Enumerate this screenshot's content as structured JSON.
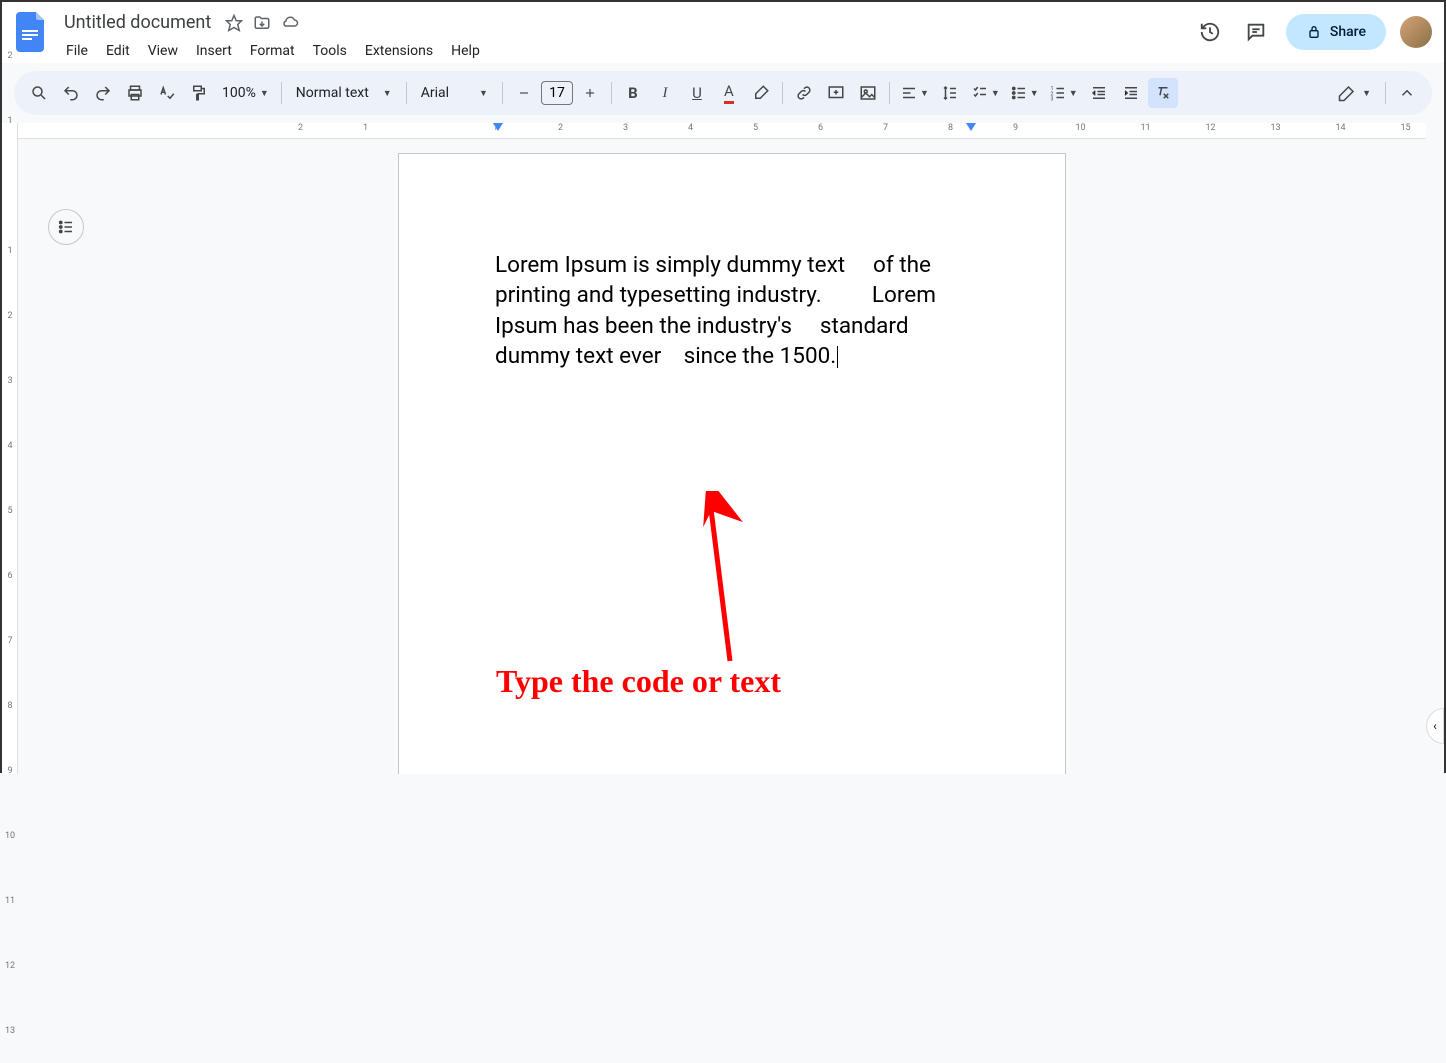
{
  "doc": {
    "title": "Untitled document",
    "content": "Lorem Ipsum is simply dummy text     of the printing and typesetting industry.         Lorem Ipsum has been the industry's     standard dummy text ever    since the 1500."
  },
  "menus": [
    "File",
    "Edit",
    "View",
    "Insert",
    "Format",
    "Tools",
    "Extensions",
    "Help"
  ],
  "toolbar": {
    "zoom": "100%",
    "style": "Normal text",
    "font": "Arial",
    "fontsize": "17"
  },
  "share": {
    "label": "Share"
  },
  "h_ruler_numbers": [
    "2",
    "1",
    "",
    "1",
    "2",
    "3",
    "4",
    "5",
    "6",
    "7",
    "8",
    "9",
    "10",
    "11",
    "12",
    "13",
    "14",
    "15"
  ],
  "v_ruler_numbers": [
    "2",
    "1",
    "",
    "1",
    "2",
    "3",
    "4",
    "5",
    "6",
    "7",
    "8",
    "9",
    "10",
    "11",
    "12",
    "13"
  ],
  "annotation": {
    "text": "Type the code or text"
  }
}
